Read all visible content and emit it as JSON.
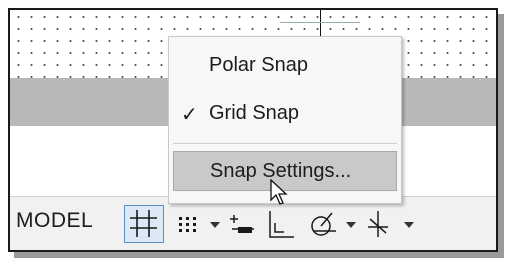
{
  "status_bar": {
    "model_label": "MODEL",
    "icons": [
      "grid-display-icon",
      "snap-mode-icon",
      "dropdown-arrow-icon",
      "infer-constraints-icon",
      "ortho-mode-icon",
      "polar-tracking-icon",
      "dropdown-arrow-icon",
      "isometric-drafting-icon",
      "dropdown-arrow-icon"
    ]
  },
  "context_menu": {
    "items": [
      {
        "label": "Polar Snap",
        "checked": false
      },
      {
        "label": "Grid Snap",
        "checked": true,
        "check_mark": "✓"
      },
      {
        "label": "Snap Settings...",
        "hovered": true
      }
    ]
  },
  "colors": {
    "gray_band": "#b8b8b8",
    "grid_button_bg": "#dce8f6",
    "grid_button_border": "#5b8ccc",
    "menu_hover": "#c9c9c9"
  }
}
